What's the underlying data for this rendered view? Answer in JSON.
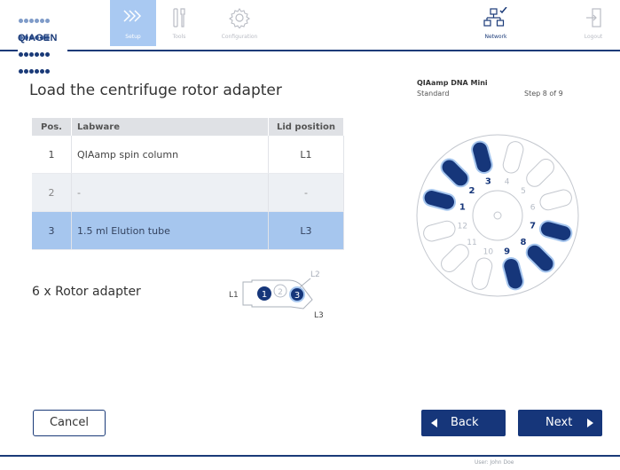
{
  "brand": {
    "name": "QIAGEN",
    "dot_color": "#1a3a78",
    "dot_color_light": "#7f9bc9"
  },
  "nav": {
    "tabs": [
      {
        "label": "Setup",
        "active": true,
        "icon": "chevrons-icon"
      },
      {
        "label": "Tools",
        "active": false,
        "icon": "tools-icon"
      },
      {
        "label": "Configuration",
        "active": false,
        "icon": "gear-icon"
      }
    ],
    "network_label": "Network",
    "logout_label": "Logout"
  },
  "page": {
    "title": "Load the centrifuge rotor adapter"
  },
  "protocol": {
    "kit": "QIAamp DNA Mini",
    "mode": "Standard",
    "step": "Step 8 of 9"
  },
  "table": {
    "headers": [
      "Pos.",
      "Labware",
      "Lid position"
    ],
    "rows": [
      {
        "pos": "1",
        "labware": "QIAamp spin column",
        "lid": "L1"
      },
      {
        "pos": "2",
        "labware": "-",
        "lid": "-"
      },
      {
        "pos": "3",
        "labware": "1.5 ml Elution tube",
        "lid": "L3"
      }
    ]
  },
  "adapter": {
    "label": "6 x Rotor adapter",
    "positions": [
      "1",
      "2",
      "3"
    ],
    "lids": [
      "L1",
      "L2",
      "L3"
    ]
  },
  "rotor": {
    "slots": [
      "1",
      "2",
      "3",
      "4",
      "5",
      "6",
      "7",
      "8",
      "9",
      "10",
      "11",
      "12"
    ],
    "loaded_slots": [
      "1",
      "2",
      "3",
      "7",
      "8",
      "9"
    ]
  },
  "buttons": {
    "cancel": "Cancel",
    "back": "Back",
    "next": "Next"
  },
  "footer": {
    "user": "User: John Doe"
  },
  "colors": {
    "primary": "#1a3a78",
    "selected_row": "#a6c6ee",
    "active_tab": "#a9c9f2"
  }
}
